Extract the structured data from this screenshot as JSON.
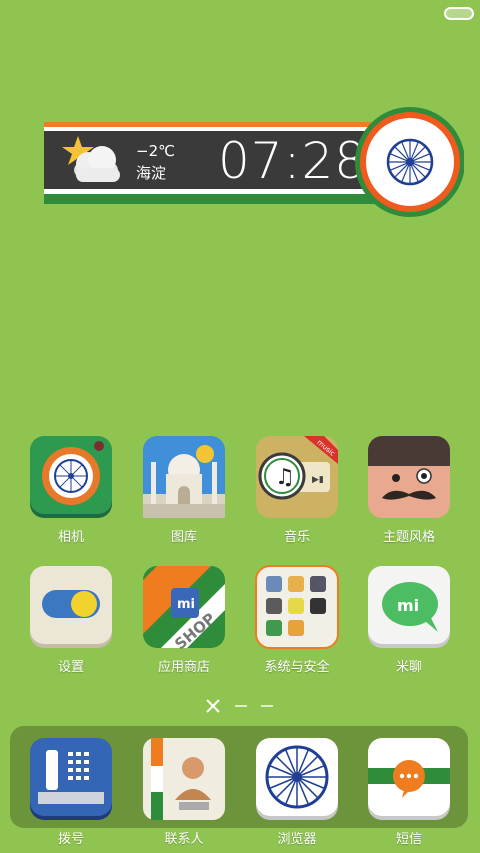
{
  "widget": {
    "temperature": "−2℃",
    "city": "海淀",
    "time": "07:28"
  },
  "apps": {
    "camera": "相机",
    "gallery": "图库",
    "music": "音乐",
    "themes": "主题风格",
    "settings": "设置",
    "app_store": "应用商店",
    "system_security": "系统与安全",
    "mitalk": "米聊"
  },
  "dock": {
    "dialer": "拨号",
    "contacts": "联系人",
    "browser": "浏览器",
    "messages": "短信"
  },
  "icon_text": {
    "music_ribbon": "music",
    "shop_ribbon": "SHOP"
  },
  "colors": {
    "background": "#8fc451",
    "saffron": "#ef7d1f",
    "india_green": "#2f8c3b",
    "chakra_blue": "#1f3f95"
  }
}
